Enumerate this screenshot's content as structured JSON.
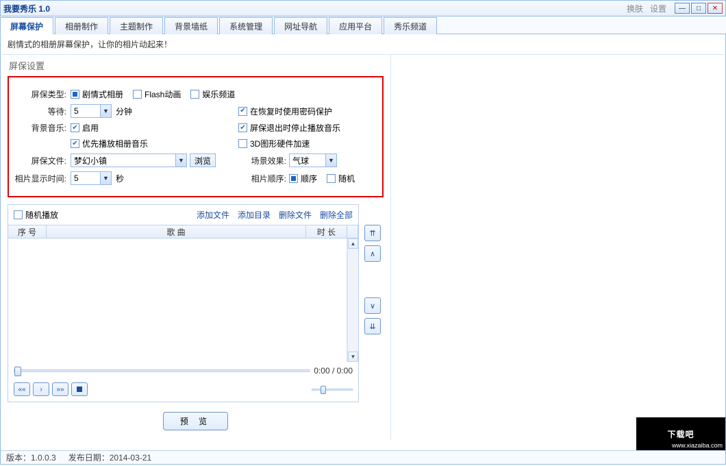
{
  "title": "我要秀乐 1.0",
  "titlebar": {
    "skin": "换肤",
    "settings": "设置"
  },
  "tabs": [
    "屏幕保护",
    "相册制作",
    "主题制作",
    "背景墙纸",
    "系统管理",
    "网址导航",
    "应用平台",
    "秀乐频道"
  ],
  "active_tab": 0,
  "subtitle": "剧情式的相册屏幕保护，让你的相片动起来！",
  "section_title": "屏保设置",
  "settings": {
    "type_label": "屏保类型:",
    "type_options": {
      "drama": "剧情式相册",
      "flash": "Flash动画",
      "entertainment": "娱乐频道"
    },
    "wait_label": "等待:",
    "wait_value": "5",
    "wait_unit": "分钟",
    "password_label": "在恢复时使用密码保护",
    "bgm_label": "背景音乐:",
    "bgm_enable": "启用",
    "stop_music_label": "屏保退出时停止播放音乐",
    "prefer_album_music": "优先播放相册音乐",
    "hw3d_label": "3D图形硬件加速",
    "file_label": "屏保文件:",
    "file_value": "梦幻小镇",
    "browse": "浏览",
    "scene_label": "场景效果:",
    "scene_value": "气球",
    "photo_time_label": "相片显示时间:",
    "photo_time_value": "5",
    "photo_time_unit": "秒",
    "order_label": "相片顺序:",
    "order_seq": "顺序",
    "order_rand": "随机"
  },
  "player": {
    "random_play": "随机播放",
    "add_file": "添加文件",
    "add_dir": "添加目录",
    "del_file": "删除文件",
    "del_all": "删除全部",
    "col_index": "序 号",
    "col_song": "歌 曲",
    "col_duration": "时 长",
    "time": "0:00 / 0:00"
  },
  "preview_btn": "预 览",
  "status": {
    "version_label": "版本：",
    "version": "1.0.0.3",
    "date_label": "发布日期：",
    "date": "2014-03-21"
  },
  "logo": "下载吧",
  "logo_url": "www.xiazaiba.com"
}
